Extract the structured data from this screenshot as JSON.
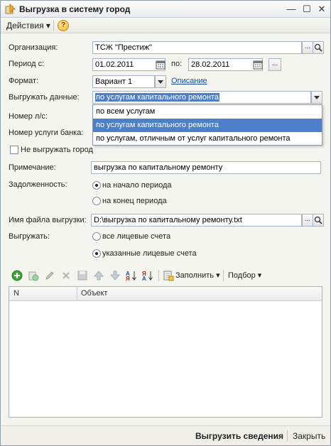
{
  "window": {
    "title": "Выгрузка в систему город"
  },
  "menu": {
    "actions_label": "Действия",
    "help_label": "?"
  },
  "form": {
    "organization": {
      "label": "Организация:",
      "value": "ТСЖ \"Престиж\""
    },
    "period": {
      "from_label": "Период с:",
      "from_value": "01.02.2011",
      "to_label": "по:",
      "to_value": "28.02.2011"
    },
    "format": {
      "label": "Формат:",
      "value": "Вариант 1",
      "link": "Описание"
    },
    "export_data": {
      "label": "Выгружать данные:",
      "value": "по услугам капитального ремонта",
      "options": [
        "по всем услугам",
        "по услугам капитального ремонта",
        "по услугам, отличным от услуг капитального ремонта"
      ],
      "selected_index": 1
    },
    "account_number_label": "Номер л/с:",
    "bank_service_label": "Номер услуги банка:",
    "no_city_export": {
      "label": "Не выгружать город",
      "checked": false
    },
    "note": {
      "label": "Примечание:",
      "value": "выгрузка по капитальному ремонту"
    },
    "debt": {
      "label": "Задолженность:",
      "options": [
        "на начало периода",
        "на конец периода"
      ],
      "selected_index": 0
    },
    "file_name": {
      "label": "Имя файла выгрузки:",
      "value": "D:\\выгрузка по капитальному ремонту.txt"
    },
    "export_scope": {
      "label": "Выгружать:",
      "options": [
        "все лицевые счета",
        "указанные лицевые счета"
      ],
      "selected_index": 1
    }
  },
  "toolbar": {
    "fill_label": "Заполнить",
    "select_label": "Подбор"
  },
  "table": {
    "columns": [
      "N",
      "Объект"
    ]
  },
  "footer": {
    "export_label": "Выгрузить сведения",
    "close_label": "Закрыть"
  }
}
